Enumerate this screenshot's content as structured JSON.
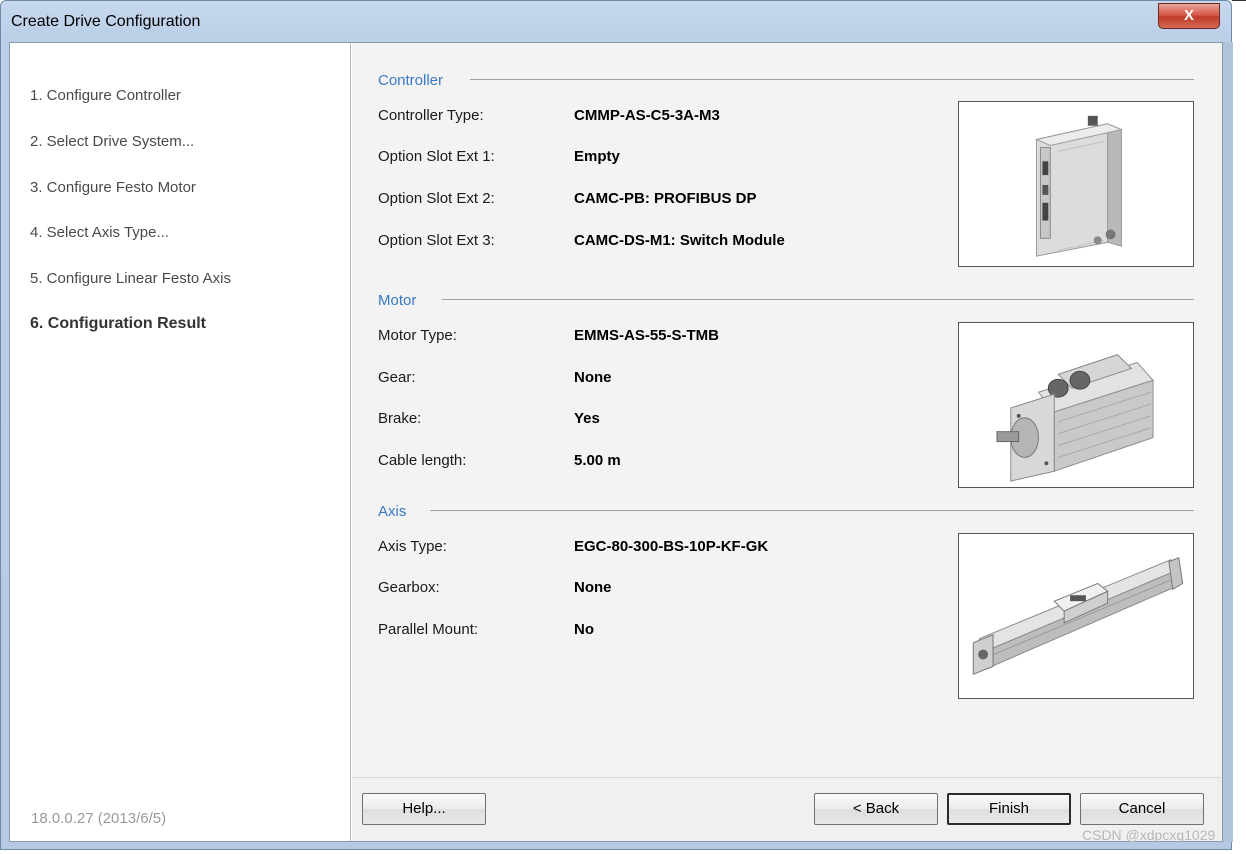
{
  "window": {
    "title": "Create Drive Configuration",
    "close_label": "X"
  },
  "sidebar": {
    "steps": [
      {
        "label": "1. Configure Controller"
      },
      {
        "label": "2. Select Drive System..."
      },
      {
        "label": "3. Configure Festo Motor"
      },
      {
        "label": "4. Select Axis Type..."
      },
      {
        "label": "5. Configure Linear Festo Axis"
      },
      {
        "label": "6. Configuration Result"
      }
    ],
    "active_step": "6. Configuration Result",
    "version": "18.0.0.27 (2013/6/5)"
  },
  "controller": {
    "title": "Controller",
    "rows": [
      {
        "label": "Controller Type:",
        "value": "CMMP-AS-C5-3A-M3"
      },
      {
        "label": "Option Slot Ext 1:",
        "value": "Empty"
      },
      {
        "label": "Option Slot Ext 2:",
        "value": "CAMC-PB: PROFIBUS DP"
      },
      {
        "label": "Option Slot Ext 3:",
        "value": "CAMC-DS-M1: Switch Module"
      }
    ]
  },
  "motor": {
    "title": "Motor",
    "rows": [
      {
        "label": "Motor Type:",
        "value": "EMMS-AS-55-S-TMB"
      },
      {
        "label": "Gear:",
        "value": "None"
      },
      {
        "label": "Brake:",
        "value": "Yes"
      },
      {
        "label": "Cable length:",
        "value": "5.00 m"
      }
    ]
  },
  "axis": {
    "title": "Axis",
    "rows": [
      {
        "label": "Axis Type:",
        "value": "EGC-80-300-BS-10P-KF-GK"
      },
      {
        "label": "Gearbox:",
        "value": "None"
      },
      {
        "label": "Parallel Mount:",
        "value": "No"
      }
    ]
  },
  "buttons": {
    "help": "Help...",
    "back": "< Back",
    "finish": "Finish",
    "cancel": "Cancel"
  },
  "watermark": "CSDN @xdpcxq1029",
  "colors": {
    "section_title": "#3a79c4",
    "close_button": "#c23a2a",
    "panel_background": "#f3f3f3"
  }
}
